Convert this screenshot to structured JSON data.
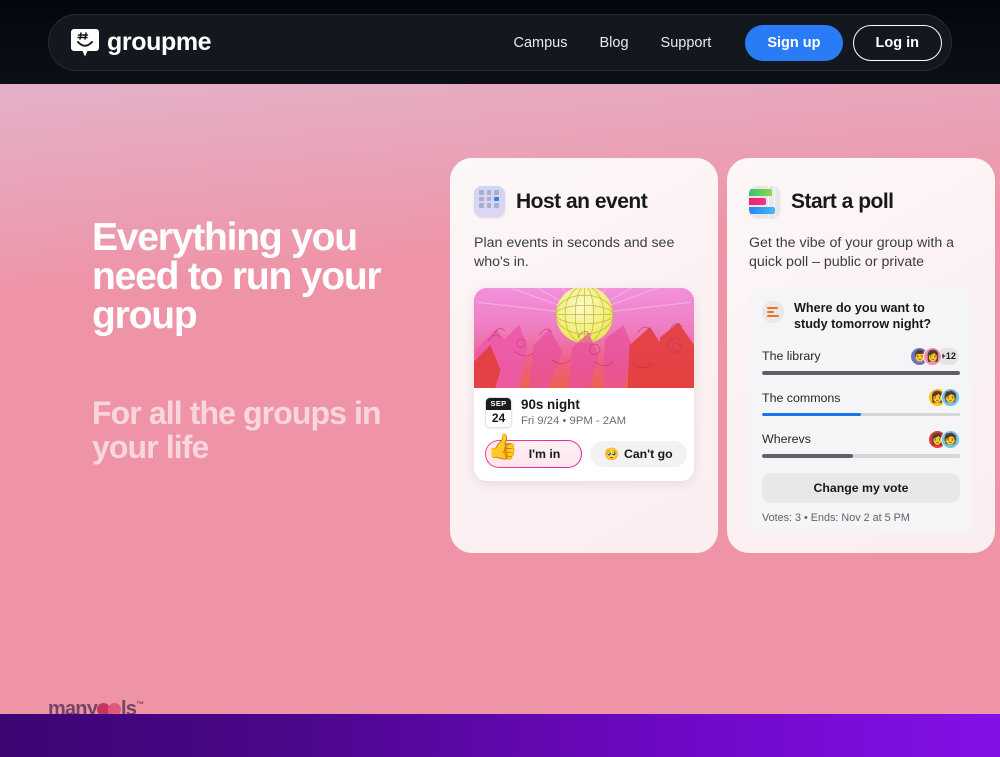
{
  "nav": {
    "brand_name": "groupme",
    "links": [
      {
        "label": "Campus"
      },
      {
        "label": "Blog"
      },
      {
        "label": "Support"
      }
    ],
    "signup_label": "Sign up",
    "login_label": "Log in"
  },
  "hero": {
    "headline": "Everything you need to run your group",
    "subhead": "For all the groups in your life"
  },
  "cards": {
    "event": {
      "title": "Host an event",
      "subtitle": "Plan events in seconds and see who's in.",
      "mock": {
        "date_month": "SEP",
        "date_day": "24",
        "event_name": "90s night",
        "event_when": "Fri 9/24 • 9PM - 2AM",
        "accept_label": "I'm in",
        "accept_emoji": "👍",
        "decline_label": "Can't go",
        "decline_emoji": "🥺"
      }
    },
    "poll": {
      "title": "Start a poll",
      "subtitle": "Get the vibe of your group with a quick poll – public or private",
      "mock": {
        "question": "Where do you want to study tomorrow night?",
        "options": [
          {
            "label": "The library",
            "percent": 100,
            "color": "#5f6167",
            "extra_count": "+12",
            "avatars": [
              "#6b74c4",
              "#ef8fb4"
            ],
            "faces": [
              "👨",
              "👩"
            ]
          },
          {
            "label": "The commons",
            "percent": 50,
            "color": "#1a73e8",
            "extra_count": "",
            "avatars": [
              "#f5c518",
              "#6ec4ea"
            ],
            "faces": [
              "👩",
              "🧑"
            ]
          },
          {
            "label": "Wherevs",
            "percent": 46,
            "color": "#5f6167",
            "extra_count": "",
            "avatars": [
              "#e8383f",
              "#6ec4ea"
            ],
            "faces": [
              "👩",
              "🧑"
            ]
          }
        ],
        "change_vote_label": "Change my vote",
        "footer": "Votes: 3 • Ends: Nov 2 at 5 PM"
      }
    }
  },
  "watermark": {
    "part1": "many",
    "part2": "ls",
    "tm": "™"
  },
  "colors": {
    "accent_blue": "#2a7bf6",
    "nav_bg": "#13181f",
    "poll_blue": "#1a73e8",
    "poll_gray": "#5f6167",
    "footer_purple_start": "#3d0572",
    "footer_purple_end": "#8410e8"
  }
}
